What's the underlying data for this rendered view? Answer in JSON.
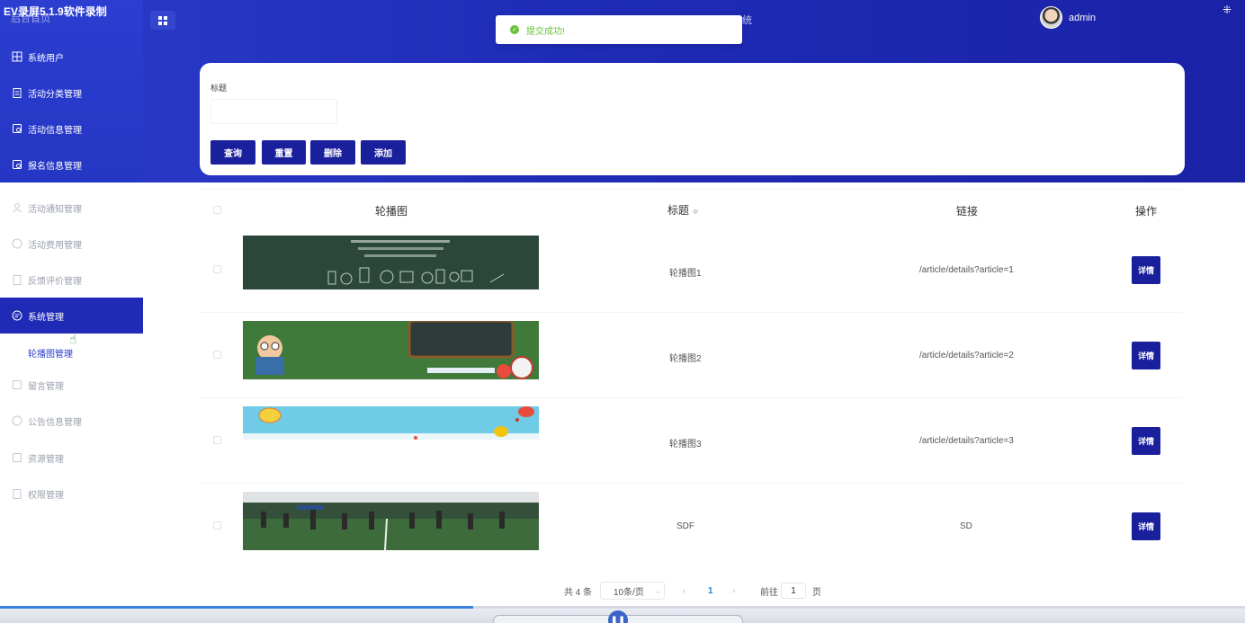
{
  "recorder": {
    "title": "EV录屏5.1.9软件录制",
    "sub": "后台首页"
  },
  "header": {
    "system_title_fragment": "统",
    "user": "admin"
  },
  "toast": {
    "message": "提交成功!"
  },
  "sidebar": {
    "items": [
      {
        "label": "系统用户",
        "icon": "grid-icon",
        "style": "dark"
      },
      {
        "label": "活动分类管理",
        "icon": "clipboard-icon",
        "style": "dark"
      },
      {
        "label": "活动信息管理",
        "icon": "doc-search-icon",
        "style": "dark"
      },
      {
        "label": "报名信息管理",
        "icon": "doc-search-icon",
        "style": "dark"
      },
      {
        "label": "活动通知管理",
        "icon": "user-icon",
        "style": "light"
      },
      {
        "label": "活动费用管理",
        "icon": "chat-icon",
        "style": "light"
      },
      {
        "label": "反馈评价管理",
        "icon": "clipboard-icon",
        "style": "light"
      },
      {
        "label": "系统管理",
        "icon": "chat-icon",
        "style": "active"
      },
      {
        "label": "留言管理",
        "icon": "doc-search-icon",
        "style": "light"
      },
      {
        "label": "公告信息管理",
        "icon": "chat-icon",
        "style": "light"
      },
      {
        "label": "资源管理",
        "icon": "doc-search-icon",
        "style": "light"
      },
      {
        "label": "权限管理",
        "icon": "clipboard-icon",
        "style": "light"
      }
    ],
    "sub_item": "轮播图管理"
  },
  "search": {
    "label": "标题",
    "value": "",
    "buttons": {
      "query": "查询",
      "reset": "重置",
      "delete": "删除",
      "add": "添加"
    }
  },
  "table": {
    "headers": {
      "image": "轮播图",
      "title": "标题",
      "link": "链接",
      "action": "操作"
    },
    "sort_icon": "sort-icon",
    "rows": [
      {
        "title": "轮播图1",
        "link": "/article/details?article=1",
        "action": "详情",
        "image": "chalkboard-banner"
      },
      {
        "title": "轮播图2",
        "link": "/article/details?article=2",
        "action": "详情",
        "image": "cartoon-classroom-banner"
      },
      {
        "title": "轮播图3",
        "link": "/article/details?article=3",
        "action": "详情",
        "image": "balloon-sky-banner"
      },
      {
        "title": "SDF",
        "link": "SD",
        "action": "详情",
        "image": "playground-photo"
      }
    ]
  },
  "pagination": {
    "total": "共 4 条",
    "page_size": "10条/页",
    "current_page": "1",
    "goto_label": "前往",
    "goto_value": "1",
    "page_unit": "页"
  },
  "player": {
    "progress": 0.38
  },
  "colors": {
    "brand": "#1a1f9c",
    "header": "#2636c4",
    "success": "#67c23a"
  }
}
